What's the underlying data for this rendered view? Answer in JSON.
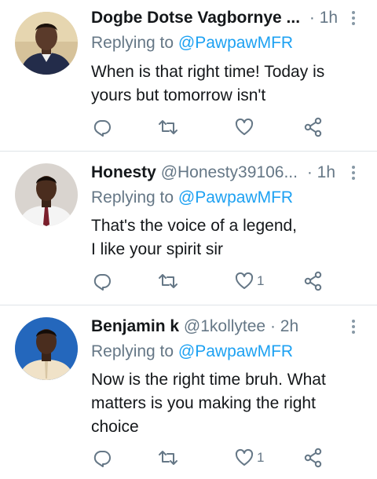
{
  "tweets": [
    {
      "name": "Dogbe Dotse Vagbornye ...",
      "handle": "",
      "time": "1h",
      "reply_prefix": "Replying to",
      "reply_mention": "@PawpawMFR",
      "lines": [
        "When is that right time! Today is",
        "yours but tomorrow isn't"
      ],
      "like_count": ""
    },
    {
      "name": "Honesty",
      "handle": "@Honesty39106...",
      "time": "1h",
      "reply_prefix": "Replying to",
      "reply_mention": "@PawpawMFR",
      "lines": [
        "That's the voice of a legend,",
        "I like your spirit sir"
      ],
      "like_count": "1"
    },
    {
      "name": "Benjamin k",
      "handle": "@1kollytee",
      "time": "2h",
      "reply_prefix": "Replying to",
      "reply_mention": "@PawpawMFR",
      "lines": [
        "Now is the right time bruh. What",
        "matters is you making the right",
        "choice"
      ],
      "like_count": "1"
    }
  ],
  "separator": "·",
  "icons": {
    "reply": "reply-icon",
    "retweet": "retweet-icon",
    "like": "like-icon",
    "share": "share-icon",
    "more": "more-vertical-icon"
  },
  "colors": {
    "text": "#14171a",
    "secondary": "#657786",
    "mention": "#1da1f2",
    "divider": "#dfe4e8"
  }
}
